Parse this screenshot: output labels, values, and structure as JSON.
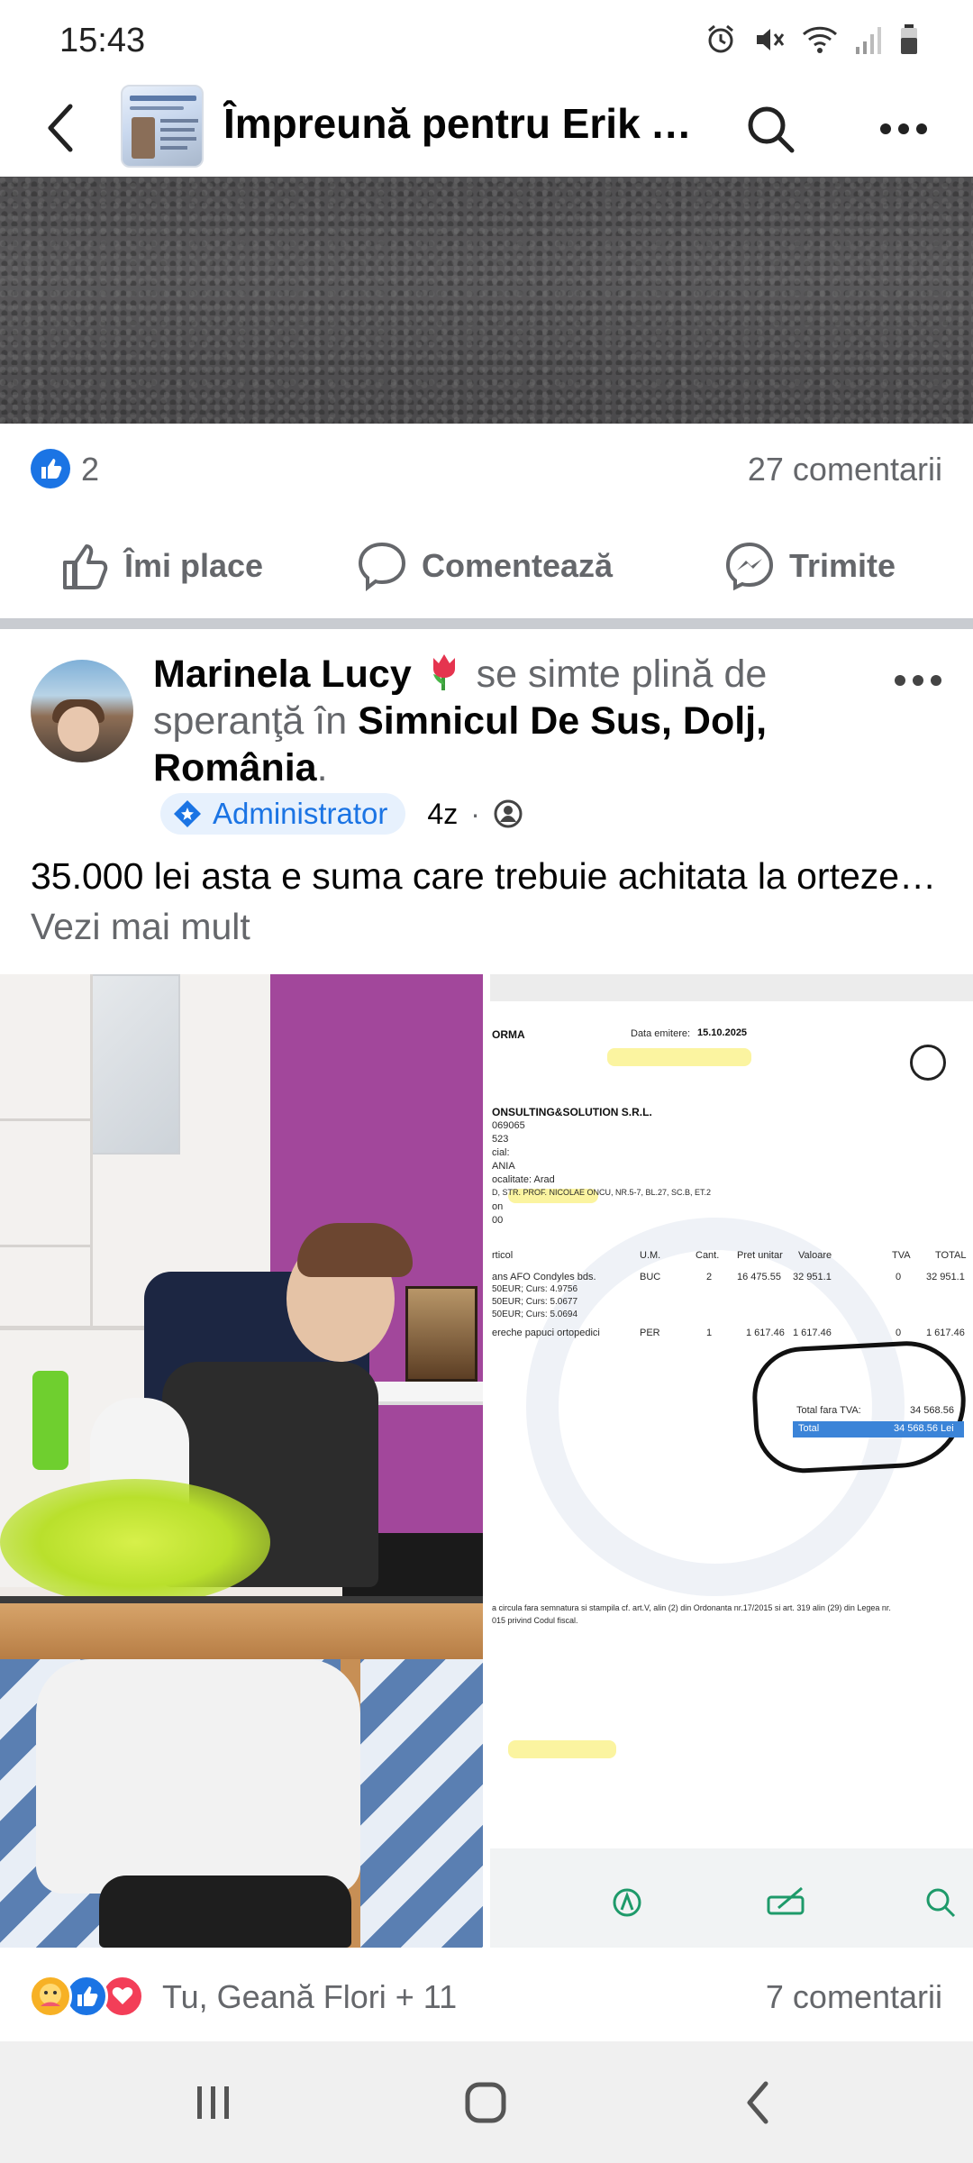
{
  "status_bar": {
    "time": "15:43",
    "icons": [
      "alarm-icon",
      "mute-icon",
      "wifi-icon",
      "signal-icon",
      "battery-icon"
    ]
  },
  "header": {
    "group_name": "Împreună pentru Erik A..."
  },
  "prev_post": {
    "like_count": "2",
    "comments": "27 comentarii",
    "actions": {
      "like": "Îmi place",
      "comment": "Comentează",
      "share": "Trimite"
    }
  },
  "post": {
    "author": "Marinela Lucy",
    "feeling_text": " se simte plină de speranţă în ",
    "location": "Simnicul De Sus, Dolj, România",
    "location_suffix": ".",
    "role_badge": "Administrator",
    "time": "4z",
    "separator": "·",
    "text": "35.000 lei asta e suma care trebuie achitata la orteze",
    "ellipsis": "… ",
    "see_more": "Vezi mai mult",
    "reactions_names": "Tu, Geană Flori + 11",
    "comments": "7 comentarii"
  },
  "invoice": {
    "title": "ORMA",
    "date_label": "Data emitere:",
    "date_value": "15.10.2025",
    "company": "ONSULTING&SOLUTION S.R.L.",
    "code": "069065",
    "line1": "523",
    "line2": "cial:",
    "line3": "ANIA",
    "line4": "ocalitate: Arad",
    "line5": "D, STR. PROF. NICOLAE ONCU, NR.5-7, BL.27, SC.B, ET.2",
    "line6": "on",
    "line7": "00",
    "col_article": "rticol",
    "col_um": "U.M.",
    "col_qty": "Cant.",
    "col_price": "Pret unitar",
    "col_value": "Valoare",
    "col_vat": "TVA",
    "col_total": "TOTAL",
    "row1_name": "ans AFO Condyles bds.",
    "row1_um": "BUC",
    "row1_qty": "2",
    "row1_price": "16 475.55",
    "row1_value": "32 951.1",
    "row1_vat": "0",
    "row1_total": "32 951.1",
    "rate1": "50EUR; Curs: 4.9756",
    "rate2": "50EUR; Curs: 5.0677",
    "rate3": "50EUR; Curs: 5.0694",
    "row2_name": "ereche papuci ortopedici",
    "row2_um": "PER",
    "row2_qty": "1",
    "row2_price": "1 617.46",
    "row2_value": "1 617.46",
    "row2_vat": "0",
    "row2_total": "1 617.46",
    "subtotal_label": "Total fara TVA:",
    "subtotal_value": "34 568.56",
    "total_label": "Total",
    "total_value": "34 568.56 Lei",
    "footer1": "a circula fara semnatura si stampila cf. art.V, alin (2) din Ordonanta nr.17/2015 si art. 319 alin (29) din Legea nr.",
    "footer2": "015 privind Codul fiscal."
  }
}
